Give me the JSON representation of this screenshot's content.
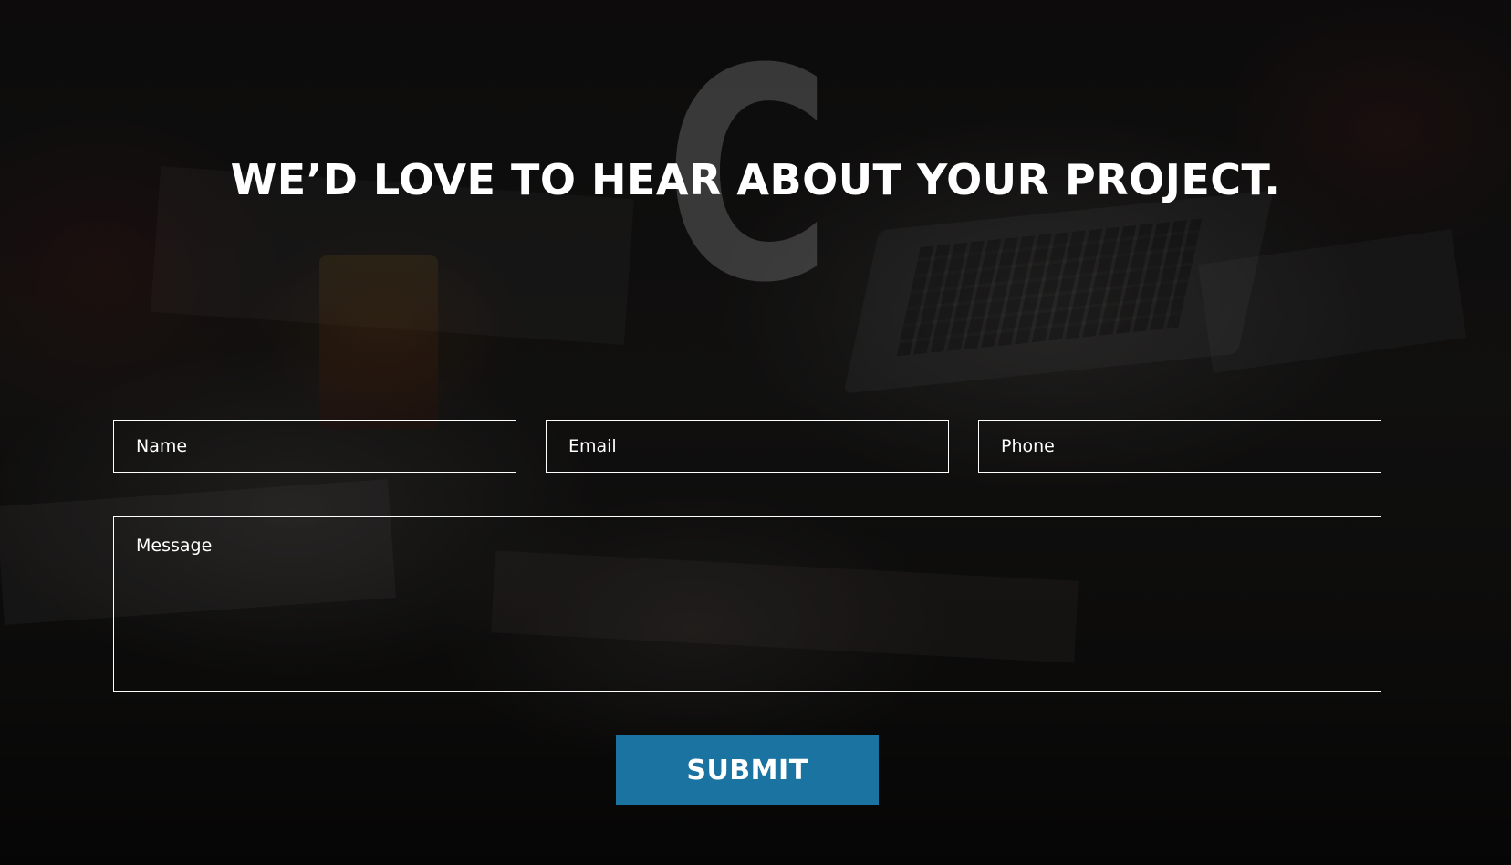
{
  "background": {
    "description_icon": "office-desk-photo",
    "overlay_color": "#000000"
  },
  "watermark": {
    "letter": "C"
  },
  "heading": {
    "text": "WE’D LOVE TO HEAR ABOUT YOUR PROJECT."
  },
  "form": {
    "name_placeholder": "Name",
    "email_placeholder": "Email",
    "phone_placeholder": "Phone",
    "message_placeholder": "Message",
    "submit_label": "SUBMIT"
  },
  "colors": {
    "accent": "#1a73a0",
    "text": "#ffffff",
    "field_border": "#ffffff"
  }
}
